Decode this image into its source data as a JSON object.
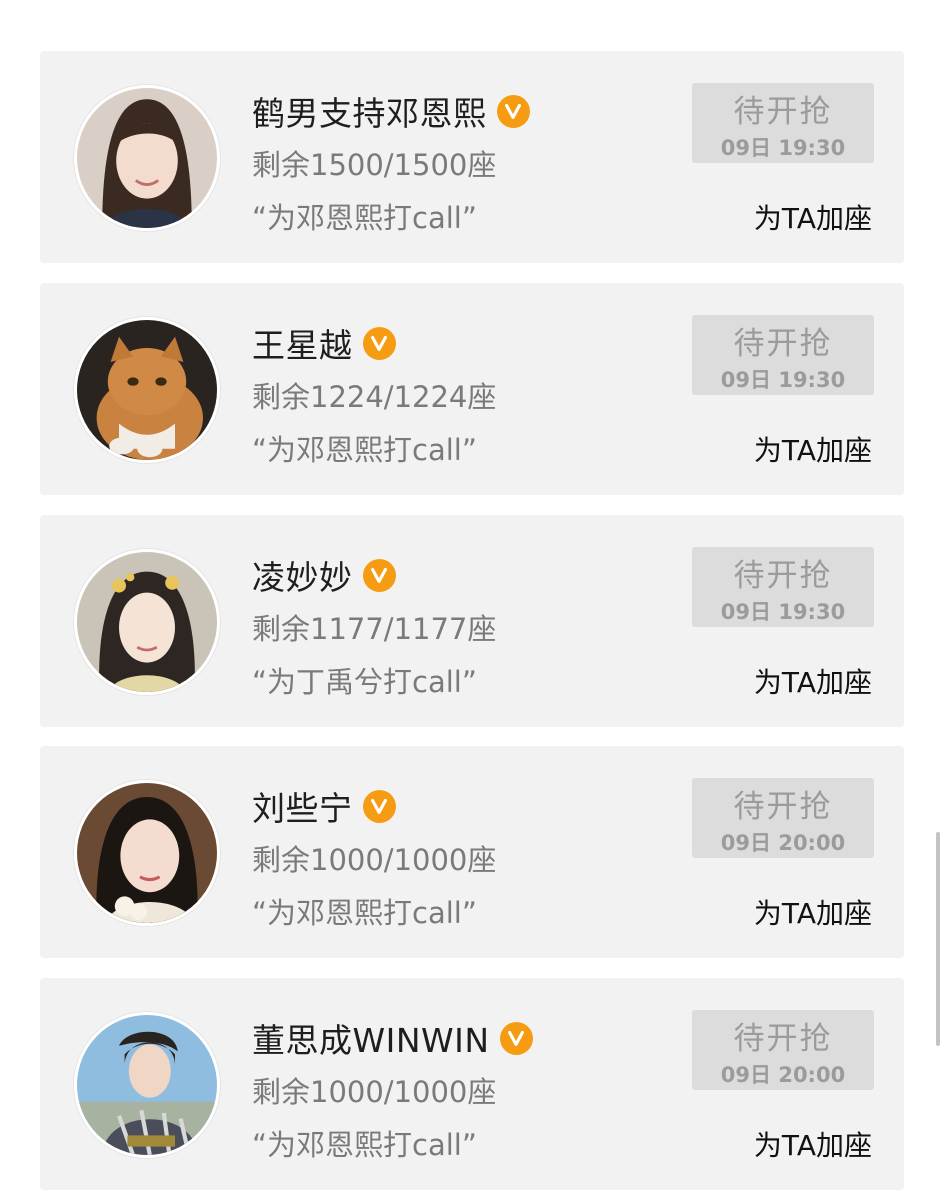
{
  "colors": {
    "card_bg": "#f2f2f2",
    "badge": "#f59c12",
    "button_bg": "#dcdcdc",
    "muted_text": "#7a7a7a"
  },
  "items": [
    {
      "name": "鹤男支持邓恩熙",
      "verified_icon": "verified-v-icon",
      "seats": "剩余1500/1500座",
      "slogan": "“为邓恩熙打call”",
      "button_label": "待开抢",
      "button_time": "09日 19:30",
      "action": "为TA加座"
    },
    {
      "name": "王星越",
      "verified_icon": "verified-v-icon",
      "seats": "剩余1224/1224座",
      "slogan": "“为邓恩熙打call”",
      "button_label": "待开抢",
      "button_time": "09日 19:30",
      "action": "为TA加座"
    },
    {
      "name": "凌妙妙",
      "verified_icon": "verified-v-icon",
      "seats": "剩余1177/1177座",
      "slogan": "“为丁禹兮打call”",
      "button_label": "待开抢",
      "button_time": "09日 19:30",
      "action": "为TA加座"
    },
    {
      "name": "刘些宁",
      "verified_icon": "verified-v-icon",
      "seats": "剩余1000/1000座",
      "slogan": "“为邓恩熙打call”",
      "button_label": "待开抢",
      "button_time": "09日 20:00",
      "action": "为TA加座"
    },
    {
      "name": "董思成WINWIN",
      "verified_icon": "verified-v-icon",
      "seats": "剩余1000/1000座",
      "slogan": "“为邓恩熙打call”",
      "button_label": "待开抢",
      "button_time": "09日 20:00",
      "action": "为TA加座"
    }
  ]
}
